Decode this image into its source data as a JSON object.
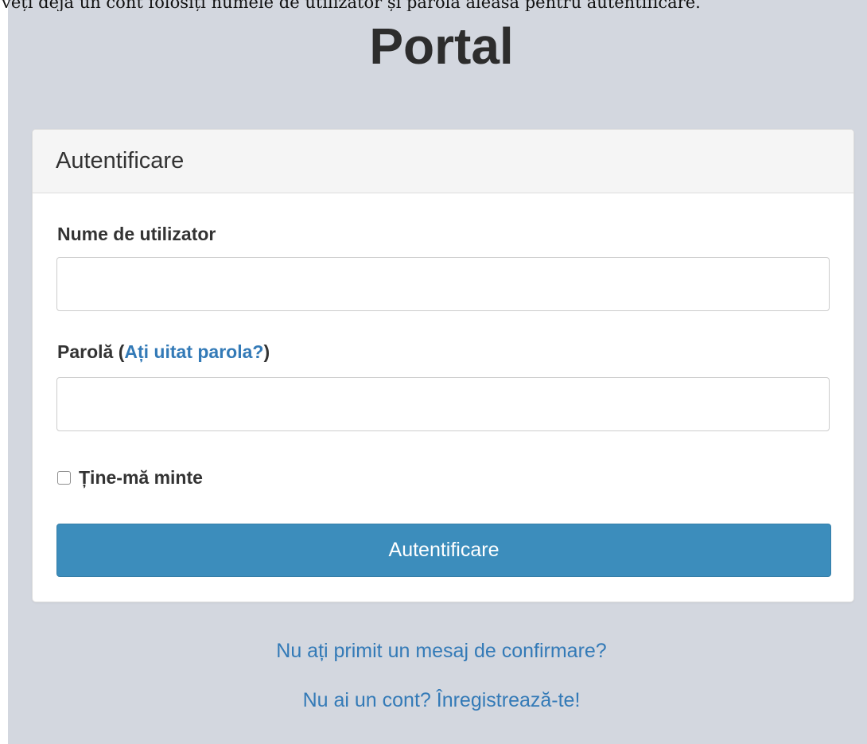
{
  "top_note": "veți deja un cont folosiți numele de utilizator și parola aleasă pentru autentificare.",
  "header": {
    "title": "Portal"
  },
  "login_panel": {
    "heading": "Autentificare",
    "username_label": "Nume de utilizator",
    "username_value": "",
    "password_label_prefix": "Parolă (",
    "forgot_password_link": "Ați uitat parola?",
    "password_label_suffix": ")",
    "password_value": "",
    "remember_me_label": "Ține-mă minte",
    "remember_me_checked": false,
    "submit_label": "Autentificare"
  },
  "footer_links": {
    "confirmation": "Nu ați primit un mesaj de confirmare?",
    "register": "Nu ai un cont? Înregistrează-te!"
  },
  "colors": {
    "page_background": "#d3d7df",
    "primary_button": "#3c8dbc",
    "link": "#337ab7",
    "panel_heading": "#f5f5f5",
    "text": "#333333"
  }
}
